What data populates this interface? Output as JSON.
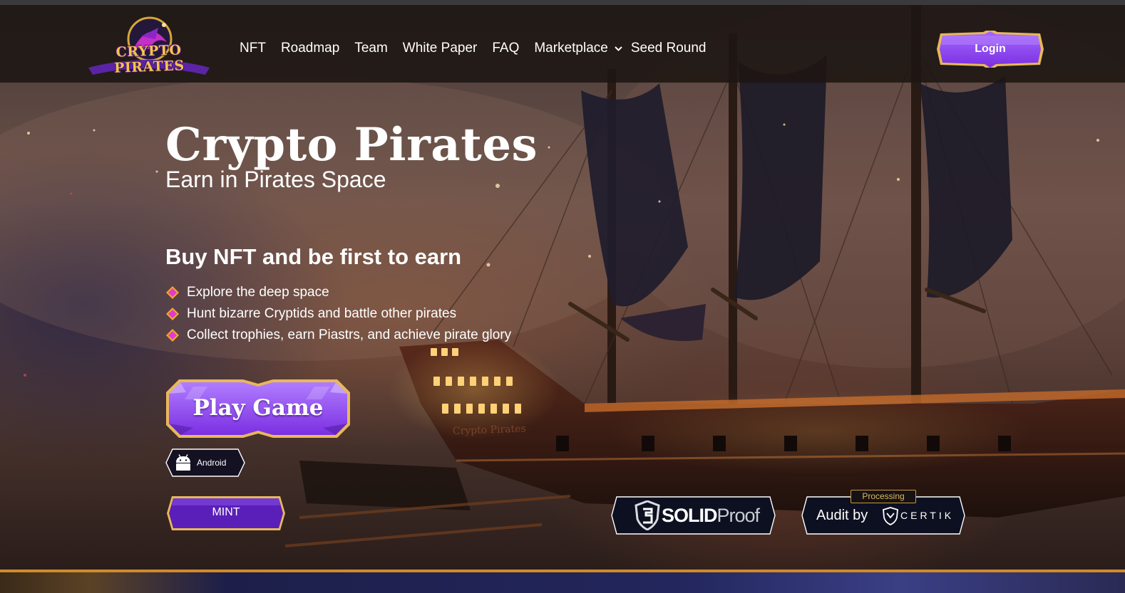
{
  "brand": {
    "logo_text": "CRYPTO PIRATES"
  },
  "nav": {
    "items": [
      "NFT",
      "Roadmap",
      "Team",
      "White Paper",
      "FAQ",
      "Marketplace",
      "Seed Round"
    ],
    "dropdown_index": 5
  },
  "header": {
    "login_label": "Login"
  },
  "hero": {
    "title": "Crypto Pirates",
    "subtitle": "Earn in Pirates Space",
    "headline": "Buy NFT and be first to earn",
    "features": [
      "Explore the deep space",
      "Hunt bizarre Cryptids and battle other pirates",
      "Collect trophies, earn Piastrs, and achieve pirate glory"
    ],
    "ship_name": "Crypto Pirates"
  },
  "actions": {
    "play_label": "Play Game",
    "android_label": "Android",
    "mint_label": "MINT"
  },
  "badges": {
    "solid_bold": "SOLID",
    "solid_light": "Proof",
    "certik_prefix": "Audit by",
    "certik_name": "CERTIK",
    "certik_status": "Processing"
  },
  "colors": {
    "accent_purple": "#8b3ff0",
    "accent_gold": "#e2b25a",
    "bullet_pink": "#e23ad0",
    "bullet_orange": "#f5a623"
  },
  "icons": {
    "bullet": "diamond-icon",
    "dropdown": "chevron-down-icon",
    "android": "android-icon",
    "solidproof": "shield-icon",
    "certik": "certik-shield-icon"
  }
}
